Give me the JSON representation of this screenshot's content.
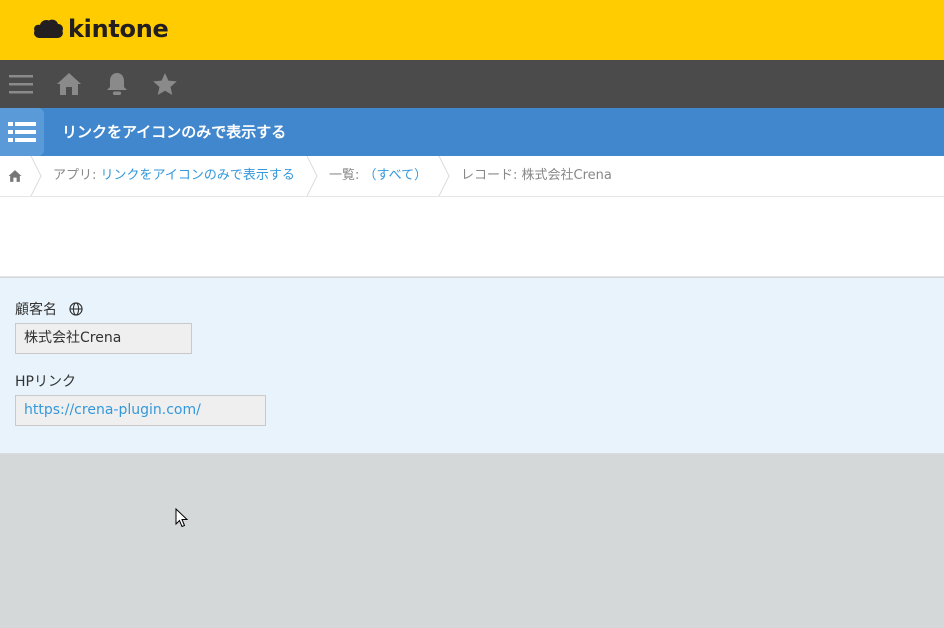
{
  "brand": {
    "name": "kintone"
  },
  "nav": {
    "menu_icon": "hamburger-icon",
    "home_icon": "home-icon",
    "notification_icon": "bell-icon",
    "favorite_icon": "star-icon"
  },
  "app": {
    "icon": "list-icon",
    "title": "リンクをアイコンのみで表示する"
  },
  "breadcrumb": {
    "home_icon": "home-icon",
    "app_prefix": "アプリ: ",
    "app_name": "リンクをアイコンのみで表示する",
    "view_prefix": "一覧: ",
    "view_name": "（すべて）",
    "record_label": "レコード: 株式会社Crena"
  },
  "record": {
    "fields": [
      {
        "label": "顧客名",
        "value": "株式会社Crena",
        "icon": "globe-icon"
      },
      {
        "label": "HPリンク",
        "value": "https://crena-plugin.com/"
      }
    ]
  },
  "colors": {
    "header_yellow": "#fecc00",
    "nav_dark": "#4b4b4b",
    "app_blue": "#4187cd",
    "link_blue": "#3498db",
    "record_bg": "#e8f3fb",
    "page_bg": "#d4d8d9"
  }
}
